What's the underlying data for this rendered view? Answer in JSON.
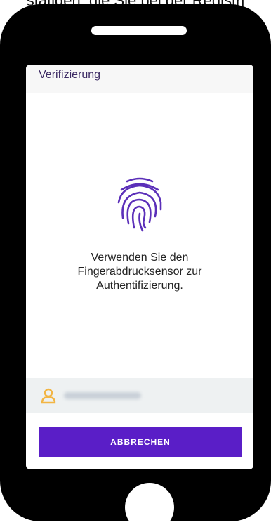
{
  "top_text": "stätigen, die Sie bei der Registri",
  "header": {
    "title": "Verifizierung"
  },
  "main": {
    "message_line1": "Verwenden Sie den",
    "message_line2": "Fingerabdrucksensor zur",
    "message_line3": "Authentifizierung."
  },
  "user": {
    "avatar_icon": "user-icon"
  },
  "actions": {
    "cancel_label": "ABBRECHEN"
  },
  "colors": {
    "accent": "#5a1ec7",
    "icon": "#5b2fb9",
    "avatar": "#f2b544"
  }
}
